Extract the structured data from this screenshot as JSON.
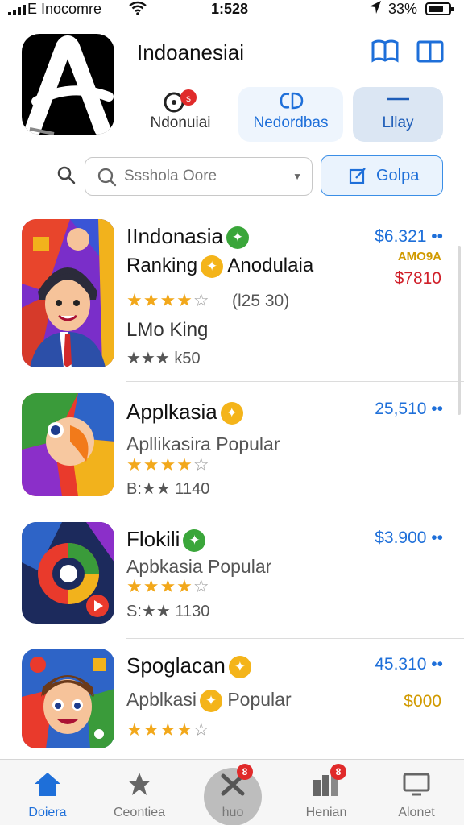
{
  "status_bar": {
    "carrier": "E Inocomre",
    "time": "1:528",
    "battery": "33%"
  },
  "header": {
    "logo_letter": "A",
    "title": "Indoanesiai",
    "icons": [
      "book-open-icon",
      "book-icon"
    ]
  },
  "segments": [
    {
      "label": "Ndonuiai",
      "badge": "s"
    },
    {
      "label": "Nedordbas"
    },
    {
      "label": "Lllay"
    }
  ],
  "search": {
    "placeholder": "Ssshola Oore",
    "button_label": "Golpa"
  },
  "apps": [
    {
      "name": "IIndonasia",
      "badge_color": "#3aa63a",
      "subtitle": "Ranking",
      "subtitle_after": "Anodulaia",
      "rating_filled": 4,
      "rating_count": "(l25 30)",
      "line3": "LMo King",
      "line4": "★★★ k50",
      "price": "$6.321 ••",
      "sub1": "AMO9A",
      "sub2": "$7810"
    },
    {
      "name": "Applkasia",
      "badge_color": "#f4b41a",
      "subtitle": "Apllikasira Popular",
      "rating_filled": 4,
      "line4": "B:★★ 1140",
      "price": "25,510 ••"
    },
    {
      "name": "Flokili",
      "badge_color": "#3aa63a",
      "subtitle": "Apbkasia Popular",
      "rating_filled": 4,
      "line4": "S:★★ 1130",
      "price": "$3.900 ••"
    },
    {
      "name": "Spoglacan",
      "badge_color": "#f4b41a",
      "subtitle": "Apblkasi",
      "subtitle_after": "Popular",
      "rating_filled": 4,
      "price": "45.310 ••",
      "sub_gold": "$000"
    }
  ],
  "tabs": [
    {
      "label": "Doiera",
      "icon": "home-icon",
      "active": true
    },
    {
      "label": "Ceontiea",
      "icon": "star-icon"
    },
    {
      "label": "huo",
      "icon": "game-icon",
      "badge": "8"
    },
    {
      "label": "Henian",
      "icon": "grid-icon",
      "badge": "8"
    },
    {
      "label": "Alonet",
      "icon": "tv-icon"
    }
  ]
}
